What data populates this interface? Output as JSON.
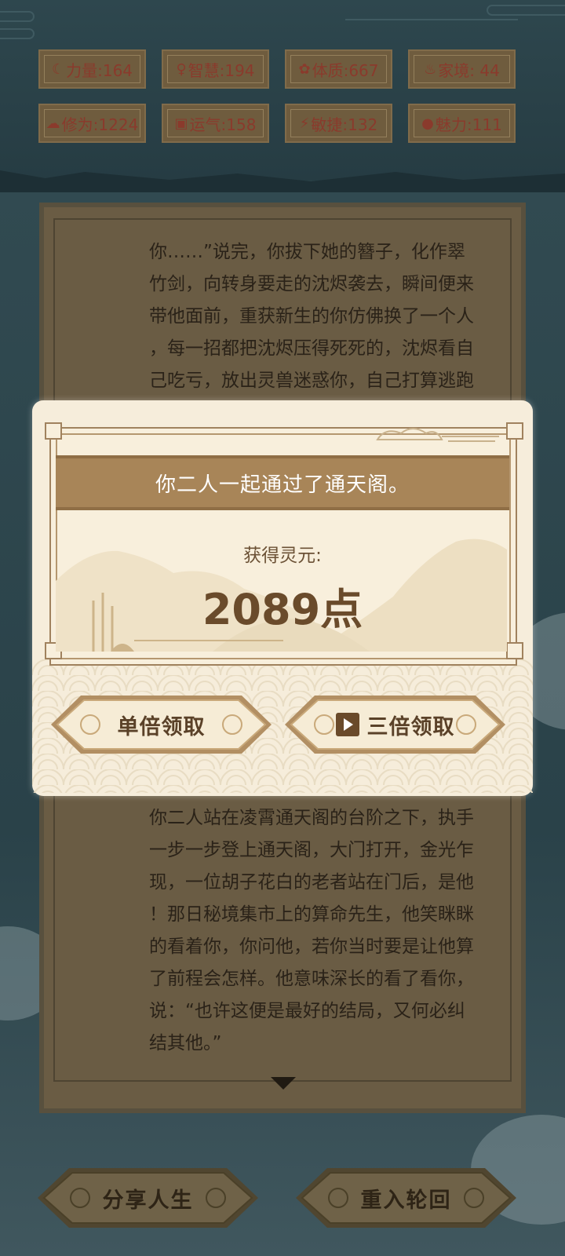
{
  "stats": [
    {
      "icon": "strength-icon",
      "glyph": "☾",
      "label": "力量:164"
    },
    {
      "icon": "wisdom-icon",
      "glyph": "♀",
      "label": "智慧:194"
    },
    {
      "icon": "constitution-icon",
      "glyph": "✿",
      "label": "体质:667"
    },
    {
      "icon": "family-icon",
      "glyph": "♨",
      "label": "家境: 44"
    },
    {
      "icon": "cultivation-icon",
      "glyph": "☁",
      "label": "修为:1224"
    },
    {
      "icon": "luck-icon",
      "glyph": "▣",
      "label": "运气:158"
    },
    {
      "icon": "agility-icon",
      "glyph": "⚡",
      "label": "敏捷:132"
    },
    {
      "icon": "charm-icon",
      "glyph": "●",
      "label": "魅力:111"
    }
  ],
  "story_top": [
    "你……”说完，你拔下她的簪子，化作翠",
    "竹剑，向转身要走的沈烬袭去，瞬间便来",
    "带他面前，重获新生的你仿佛换了一个人",
    "，每一招都把沈烬压得死死的，沈烬看自",
    "己吃亏，放出灵兽迷惑你，自己打算逃跑"
  ],
  "story_bottom": [
    "你二人站在凌霄通天阁的台阶之下，执手",
    "一步一步登上通天阁，大门打开，金光乍",
    "现，一位胡子花白的老者站在门后，是他",
    "！那日秘境集市上的算命先生，他笑眯眯",
    "的看着你，你问他，若你当时要是让他算",
    "了前程会怎样。他意味深长的看了看你，",
    "说：“也许这便是最好的结局，又何必纠",
    "结其他。”"
  ],
  "modal": {
    "title": "你二人一起通过了通天阁。",
    "reward_label": "获得灵元:",
    "reward_value": "2089点",
    "single_button": "单倍领取",
    "triple_button": "三倍领取"
  },
  "bottom_buttons": {
    "share": "分享人生",
    "restart": "重入轮回"
  }
}
